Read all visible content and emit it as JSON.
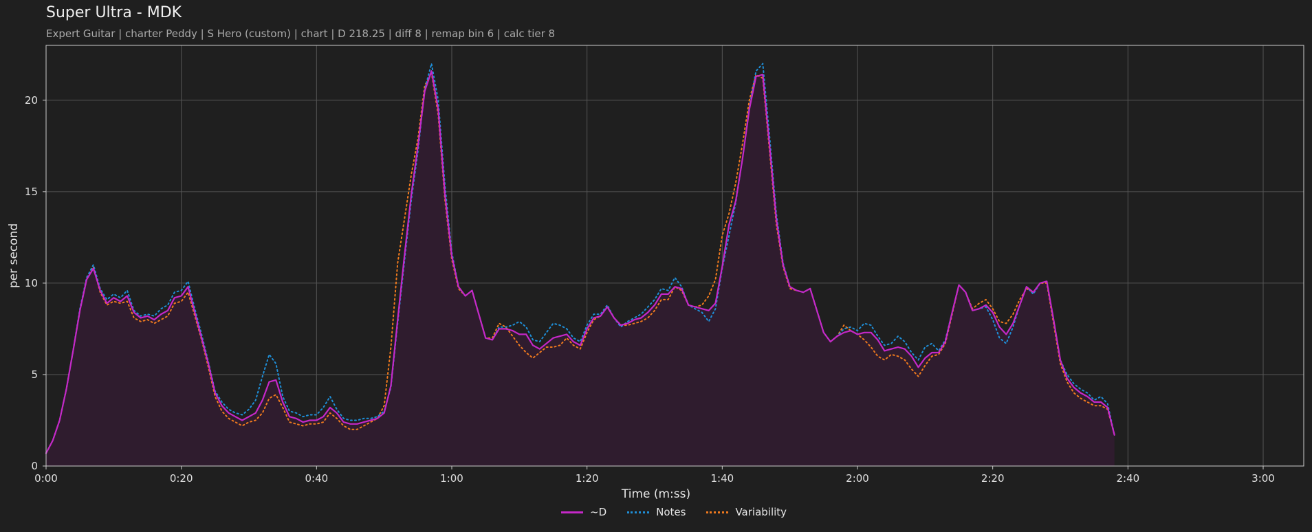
{
  "header": {
    "title": "Super Ultra - MDK",
    "subtitle": "Expert Guitar  |  charter Peddy  |  S Hero (custom)  |  chart  |  D 218.25  |  diff 8  |  remap bin 6  |  calc tier 8"
  },
  "colors": {
    "background": "#1f1f1f",
    "d_line": "#c528c8",
    "notes_line": "#1f8fd8",
    "variability_line": "#f07a1e",
    "fill": "#2f1c2e",
    "grid": "#555555"
  },
  "chart_data": {
    "type": "line",
    "title": "Super Ultra - MDK",
    "xlabel": "Time (m:ss)",
    "ylabel": "per second",
    "xlim": [
      0,
      186
    ],
    "ylim": [
      0,
      23
    ],
    "x_ticks": [
      0,
      20,
      40,
      60,
      80,
      100,
      120,
      140,
      160,
      180
    ],
    "x_tick_labels": [
      "0:00",
      "0:20",
      "0:40",
      "1:00",
      "1:20",
      "1:40",
      "2:00",
      "2:20",
      "2:40",
      "3:00"
    ],
    "y_ticks": [
      0,
      5,
      10,
      15,
      20
    ],
    "y_tick_labels": [
      "0",
      "5",
      "10",
      "15",
      "20"
    ],
    "grid": true,
    "legend": "bottom-center",
    "x": [
      0,
      1,
      2,
      3,
      4,
      5,
      6,
      7,
      8,
      9,
      10,
      11,
      12,
      13,
      14,
      15,
      16,
      17,
      18,
      19,
      20,
      21,
      22,
      23,
      24,
      25,
      26,
      27,
      28,
      29,
      30,
      31,
      32,
      33,
      34,
      35,
      36,
      37,
      38,
      39,
      40,
      41,
      42,
      43,
      44,
      45,
      46,
      47,
      48,
      49,
      50,
      51,
      52,
      53,
      54,
      55,
      56,
      57,
      58,
      59,
      60,
      61,
      62,
      63,
      64,
      65,
      66,
      67,
      68,
      69,
      70,
      71,
      72,
      73,
      74,
      75,
      76,
      77,
      78,
      79,
      80,
      81,
      82,
      83,
      84,
      85,
      86,
      87,
      88,
      89,
      90,
      91,
      92,
      93,
      94,
      95,
      96,
      97,
      98,
      99,
      100,
      101,
      102,
      103,
      104,
      105,
      106,
      107,
      108,
      109,
      110,
      111,
      112,
      113,
      114,
      115,
      116,
      117,
      118,
      119,
      120,
      121,
      122,
      123,
      124,
      125,
      126,
      127,
      128,
      129,
      130,
      131,
      132,
      133,
      134,
      135,
      136,
      137,
      138,
      139,
      140,
      141,
      142,
      143,
      144,
      145,
      146,
      147,
      148,
      149,
      150,
      151,
      152,
      153,
      154,
      155,
      156,
      157,
      158,
      159,
      160,
      161,
      162,
      163,
      164,
      165,
      166,
      167,
      168,
      169,
      170,
      171,
      172,
      173,
      174,
      175,
      176,
      177,
      178,
      179,
      180,
      181,
      182,
      183,
      184,
      185,
      186
    ],
    "series": [
      {
        "name": "~D",
        "style": "solid",
        "values": [
          0.7,
          1.4,
          2.5,
          4.2,
          6.3,
          8.5,
          10.2,
          10.8,
          9.6,
          8.9,
          9.2,
          9.0,
          9.3,
          8.4,
          8.1,
          8.2,
          8.0,
          8.3,
          8.5,
          9.2,
          9.3,
          9.8,
          8.4,
          7.0,
          5.6,
          4.0,
          3.3,
          2.9,
          2.7,
          2.5,
          2.7,
          2.9,
          3.6,
          4.6,
          4.7,
          3.5,
          2.7,
          2.6,
          2.4,
          2.5,
          2.5,
          2.7,
          3.2,
          2.9,
          2.4,
          2.3,
          2.3,
          2.4,
          2.5,
          2.6,
          2.9,
          4.4,
          8.0,
          11.5,
          14.8,
          17.5,
          20.5,
          21.6,
          19.5,
          14.8,
          11.5,
          9.8,
          9.3,
          9.6,
          8.3,
          7.0,
          6.9,
          7.5,
          7.5,
          7.4,
          7.2,
          7.2,
          6.6,
          6.4,
          6.7,
          7.0,
          7.1,
          7.2,
          6.8,
          6.6,
          7.5,
          8.1,
          8.2,
          8.7,
          8.1,
          7.7,
          7.8,
          8.0,
          8.1,
          8.4,
          8.8,
          9.4,
          9.4,
          9.8,
          9.7,
          8.8,
          8.7,
          8.6,
          8.5,
          8.9,
          10.9,
          13.2,
          14.5,
          16.8,
          19.5,
          21.3,
          21.4,
          17.5,
          13.5,
          11.0,
          9.8,
          9.6,
          9.5,
          9.7,
          8.5,
          7.3,
          6.8,
          7.1,
          7.3,
          7.4,
          7.2,
          7.3,
          7.3,
          6.9,
          6.3,
          6.4,
          6.5,
          6.4,
          6.0,
          5.4,
          5.9,
          6.2,
          6.2,
          6.8,
          8.4,
          9.9,
          9.5,
          8.5,
          8.6,
          8.8,
          8.4,
          7.6,
          7.2,
          7.8,
          8.8,
          9.8,
          9.5,
          10.0,
          10.1,
          8.0,
          5.8,
          4.8,
          4.3,
          4.0,
          3.8,
          3.5,
          3.5,
          3.2,
          1.7
        ]
      },
      {
        "name": "Notes",
        "style": "dotted",
        "values": [
          0.7,
          1.4,
          2.5,
          4.2,
          6.3,
          8.6,
          10.3,
          11.0,
          9.7,
          9.1,
          9.4,
          9.2,
          9.6,
          8.5,
          8.2,
          8.3,
          8.2,
          8.6,
          8.8,
          9.5,
          9.6,
          10.1,
          8.6,
          7.2,
          5.7,
          4.1,
          3.5,
          3.1,
          2.9,
          2.8,
          3.1,
          3.6,
          4.9,
          6.1,
          5.6,
          3.8,
          3.0,
          2.9,
          2.7,
          2.8,
          2.8,
          3.2,
          3.8,
          3.1,
          2.6,
          2.5,
          2.5,
          2.6,
          2.6,
          2.7,
          3.0,
          4.3,
          7.8,
          11.2,
          14.5,
          17.2,
          20.6,
          22.0,
          20.0,
          15.3,
          11.7,
          9.8,
          9.3,
          9.6,
          8.3,
          7.0,
          6.9,
          7.6,
          7.6,
          7.7,
          7.9,
          7.6,
          6.9,
          6.8,
          7.3,
          7.8,
          7.7,
          7.5,
          7.0,
          6.8,
          7.7,
          8.3,
          8.3,
          8.8,
          8.1,
          7.6,
          7.9,
          8.1,
          8.3,
          8.7,
          9.1,
          9.7,
          9.6,
          10.3,
          9.8,
          8.8,
          8.6,
          8.4,
          7.9,
          8.6,
          10.8,
          12.6,
          14.4,
          16.8,
          19.6,
          21.6,
          22.0,
          18.0,
          13.8,
          11.1,
          9.8,
          9.6,
          9.5,
          9.7,
          8.5,
          7.3,
          6.8,
          7.1,
          7.5,
          7.6,
          7.4,
          7.8,
          7.7,
          7.1,
          6.6,
          6.7,
          7.1,
          6.8,
          6.2,
          5.8,
          6.5,
          6.7,
          6.3,
          6.9,
          8.4,
          9.9,
          9.5,
          8.5,
          8.6,
          8.7,
          8.0,
          7.0,
          6.7,
          7.6,
          8.8,
          9.8,
          9.4,
          10.0,
          10.1,
          8.0,
          5.8,
          5.0,
          4.5,
          4.2,
          4.0,
          3.6,
          3.8,
          3.4,
          1.7
        ]
      },
      {
        "name": "Variability",
        "style": "dotted",
        "values": [
          0.7,
          1.4,
          2.5,
          4.2,
          6.3,
          8.5,
          10.2,
          10.9,
          9.5,
          8.8,
          9.0,
          8.9,
          9.0,
          8.1,
          7.9,
          8.0,
          7.8,
          8.0,
          8.2,
          8.9,
          9.0,
          9.5,
          8.2,
          6.9,
          5.4,
          3.8,
          3.0,
          2.6,
          2.4,
          2.2,
          2.4,
          2.5,
          2.9,
          3.7,
          3.9,
          3.2,
          2.4,
          2.3,
          2.2,
          2.3,
          2.3,
          2.4,
          2.9,
          2.6,
          2.2,
          2.0,
          2.0,
          2.2,
          2.4,
          2.6,
          3.3,
          6.5,
          11.1,
          13.5,
          15.9,
          17.9,
          20.8,
          21.5,
          19.2,
          14.5,
          11.3,
          9.7,
          9.3,
          9.6,
          8.3,
          7.0,
          7.0,
          7.8,
          7.6,
          7.1,
          6.6,
          6.2,
          5.9,
          6.2,
          6.5,
          6.5,
          6.6,
          7.0,
          6.6,
          6.4,
          7.3,
          8.0,
          8.2,
          8.7,
          8.1,
          7.7,
          7.7,
          7.8,
          7.9,
          8.1,
          8.5,
          9.1,
          9.1,
          9.8,
          9.6,
          8.8,
          8.7,
          8.8,
          9.3,
          10.2,
          12.6,
          13.8,
          15.5,
          17.6,
          20.0,
          21.4,
          21.2,
          17.2,
          13.2,
          10.9,
          9.7,
          9.6,
          9.5,
          9.7,
          8.5,
          7.3,
          6.8,
          7.1,
          7.7,
          7.4,
          7.2,
          6.9,
          6.5,
          6.0,
          5.8,
          6.1,
          6.0,
          5.8,
          5.3,
          4.9,
          5.5,
          6.0,
          6.1,
          6.7,
          8.3,
          9.9,
          9.5,
          8.6,
          8.9,
          9.1,
          8.6,
          7.9,
          7.8,
          8.3,
          9.1,
          9.7,
          9.5,
          10.0,
          10.0,
          7.8,
          5.6,
          4.6,
          4.0,
          3.7,
          3.5,
          3.3,
          3.3,
          3.1,
          1.7
        ]
      }
    ]
  }
}
